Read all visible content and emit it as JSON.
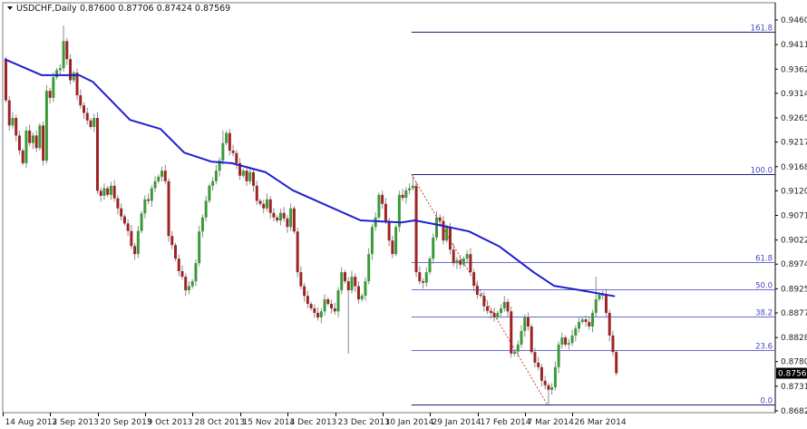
{
  "header": {
    "symbol_period": "USDCHF,Daily",
    "ohlc": "0.87600 0.87706 0.87424 0.87569",
    "menu_icon": "triangle-down-icon"
  },
  "chart_data": {
    "type": "candlestick",
    "symbol": "USDCHF",
    "timeframe": "Daily",
    "ylim": [
      0.8682,
      0.946
    ],
    "first_open": 0.9382,
    "closes": [
      0.93,
      0.925,
      0.9265,
      0.923,
      0.92,
      0.9175,
      0.924,
      0.9215,
      0.923,
      0.9205,
      0.925,
      0.918,
      0.9319,
      0.9305,
      0.9346,
      0.936,
      0.9364,
      0.9418,
      0.9382,
      0.934,
      0.9355,
      0.931,
      0.929,
      0.9275,
      0.926,
      0.9247,
      0.9265,
      0.912,
      0.911,
      0.9125,
      0.9112,
      0.913,
      0.9105,
      0.9085,
      0.9069,
      0.9055,
      0.904,
      0.901,
      0.8994,
      0.904,
      0.9075,
      0.9103,
      0.91,
      0.9125,
      0.9139,
      0.9148,
      0.916,
      0.9139,
      0.903,
      0.9012,
      0.8985,
      0.896,
      0.8949,
      0.8922,
      0.893,
      0.894,
      0.8976,
      0.9039,
      0.9067,
      0.91,
      0.913,
      0.9139,
      0.916,
      0.918,
      0.9215,
      0.9235,
      0.92,
      0.9195,
      0.9175,
      0.915,
      0.916,
      0.9139,
      0.9157,
      0.913,
      0.91,
      0.9094,
      0.9085,
      0.9103,
      0.9076,
      0.9067,
      0.9061,
      0.9076,
      0.9065,
      0.9048,
      0.9085,
      0.9039,
      0.8958,
      0.893,
      0.8911,
      0.8895,
      0.8886,
      0.8877,
      0.8868,
      0.888,
      0.8904,
      0.8895,
      0.8886,
      0.888,
      0.8922,
      0.8958,
      0.894,
      0.8922,
      0.8949,
      0.893,
      0.8904,
      0.8911,
      0.894,
      0.8994,
      0.9048,
      0.9067,
      0.9112,
      0.9094,
      0.906,
      0.9021,
      0.8994,
      0.9048,
      0.9112,
      0.9106,
      0.9121,
      0.9125,
      0.913,
      0.8958,
      0.894,
      0.8937,
      0.8958,
      0.8985,
      0.9027,
      0.9067,
      0.906,
      0.9021,
      0.9048,
      0.9003,
      0.8976,
      0.8982,
      0.8973,
      0.8985,
      0.8994,
      0.8958,
      0.8931,
      0.8913,
      0.8911,
      0.889,
      0.8881,
      0.8877,
      0.8868,
      0.8877,
      0.8886,
      0.8899,
      0.888,
      0.8796,
      0.88,
      0.8814,
      0.8841,
      0.8868,
      0.885,
      0.8799,
      0.8778,
      0.8769,
      0.8742,
      0.8733,
      0.8724,
      0.8729,
      0.8769,
      0.8814,
      0.8828,
      0.8814,
      0.8817,
      0.8832,
      0.8846,
      0.8859,
      0.8864,
      0.8859,
      0.885,
      0.8877,
      0.8904,
      0.8913,
      0.8913,
      0.8877,
      0.8832,
      0.8799,
      0.8757
    ],
    "wick": 0.0009,
    "high_overrides": {
      "17": 0.9449,
      "64": 0.924,
      "120": 0.9153,
      "174": 0.8949
    },
    "low_overrides": {
      "101": 0.8796,
      "160": 0.8695
    },
    "moving_average": {
      "color": "#1f1fcf",
      "points": [
        [
          0,
          0.9382
        ],
        [
          11,
          0.935
        ],
        [
          22,
          0.935
        ],
        [
          26,
          0.9337
        ],
        [
          37,
          0.9261
        ],
        [
          46,
          0.9243
        ],
        [
          53,
          0.9196
        ],
        [
          61,
          0.9178
        ],
        [
          67,
          0.9175
        ],
        [
          77,
          0.9157
        ],
        [
          85,
          0.9121
        ],
        [
          94,
          0.9094
        ],
        [
          105,
          0.9061
        ],
        [
          117,
          0.9057
        ],
        [
          121,
          0.9061
        ],
        [
          128,
          0.9052
        ],
        [
          137,
          0.9039
        ],
        [
          146,
          0.9009
        ],
        [
          156,
          0.8958
        ],
        [
          162,
          0.8931
        ],
        [
          170,
          0.8922
        ],
        [
          180,
          0.891
        ]
      ]
    },
    "fibonacci": {
      "from_bar": 120,
      "to_bar": 160,
      "price_100": 0.9153,
      "price_0": 0.8695,
      "levels": [
        {
          "label": "161.8",
          "ratio": 1.618
        },
        {
          "label": "100.0",
          "ratio": 1.0
        },
        {
          "label": "61.8",
          "ratio": 0.618
        },
        {
          "label": "50.0",
          "ratio": 0.5
        },
        {
          "label": "38.2",
          "ratio": 0.382
        },
        {
          "label": "23.6",
          "ratio": 0.236
        },
        {
          "label": "0.0",
          "ratio": 0.0
        }
      ]
    },
    "y_ticks": [
      "0.94600",
      "0.94110",
      "0.93620",
      "0.93140",
      "0.92650",
      "0.92170",
      "0.91680",
      "0.91200",
      "0.90710",
      "0.90220",
      "0.89740",
      "0.89250",
      "0.88770",
      "0.88280",
      "0.87800",
      "0.87310",
      "0.86820"
    ],
    "x_ticks": [
      {
        "label": "14 Aug 2013",
        "bar": 0
      },
      {
        "label": "2 Sep 2013",
        "bar": 14
      },
      {
        "label": "20 Sep 2013",
        "bar": 28
      },
      {
        "label": "9 Oct 2013",
        "bar": 42
      },
      {
        "label": "28 Oct 2013",
        "bar": 56
      },
      {
        "label": "15 Nov 2013",
        "bar": 70
      },
      {
        "label": "4 Dec 2013",
        "bar": 84
      },
      {
        "label": "23 Dec 2013",
        "bar": 98
      },
      {
        "label": "10 Jan 2014",
        "bar": 112
      },
      {
        "label": "29 Jan 2014",
        "bar": 126
      },
      {
        "label": "17 Feb 2014",
        "bar": 140
      },
      {
        "label": "7 Mar 2014",
        "bar": 154
      },
      {
        "label": "26 Mar 2014",
        "bar": 168
      }
    ],
    "current_price": "0.87569",
    "colors": {
      "bull": "#3a9a3a",
      "bear": "#9e2424",
      "wick": "#8a8a8a",
      "fib_main": "#1c1c78",
      "fib_inner": "#6b6bd0",
      "trend": "#d04040"
    }
  }
}
